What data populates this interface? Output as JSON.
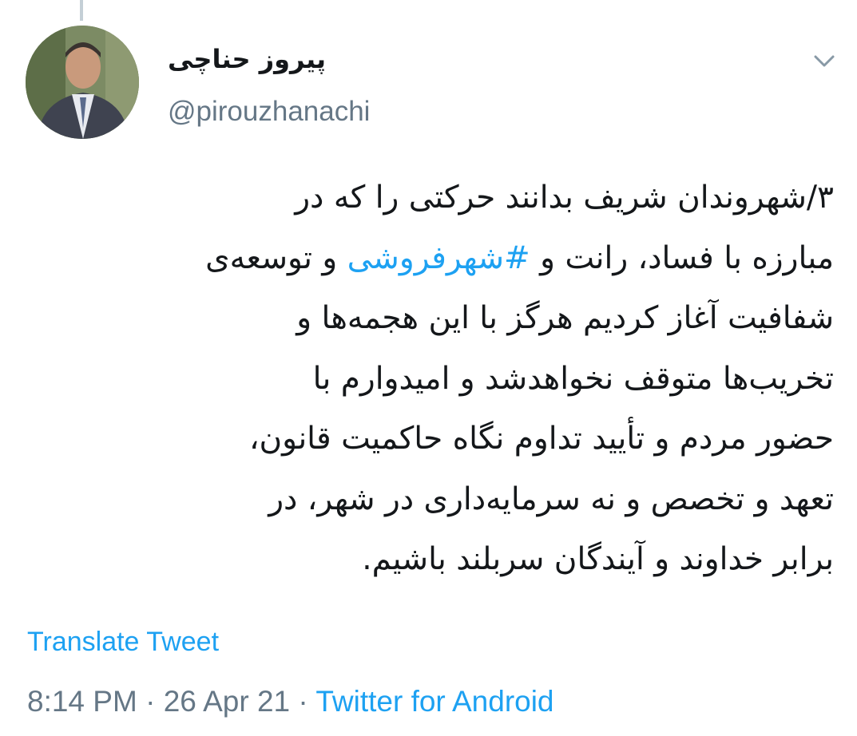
{
  "tweet": {
    "author_name": "پیروز حناچی",
    "handle": "@pirouzhanachi",
    "lines": [
      "۳/شهروندان شریف بدانند حرکتی را که در",
      "مبارزه با فساد، رانت و ",
      "شفافیت آغاز کردیم هرگز با این هجمه‌ها و",
      "تخریب‌ها متوقف نخواهدشد و امیدوارم با",
      "حضور مردم و تأیید تداوم نگاه حاکمیت قانون،",
      "تعهد و تخصص و نه سرمایه‌داری در شهر، در",
      "برابر خداوند و آیندگان سربلند باشیم."
    ],
    "hashtag": "#شهرفروشی",
    "line2_after_hashtag": " و توسعه‌ی",
    "translate_label": "Translate Tweet",
    "time": "8:14 PM",
    "separator": "·",
    "date": "26 Apr 21",
    "source": "Twitter for Android"
  },
  "colors": {
    "link": "#1da1f2",
    "muted": "#657786",
    "text": "#14171a"
  },
  "icons": {
    "menu": "chevron-down-icon",
    "avatar": "profile-photo"
  }
}
